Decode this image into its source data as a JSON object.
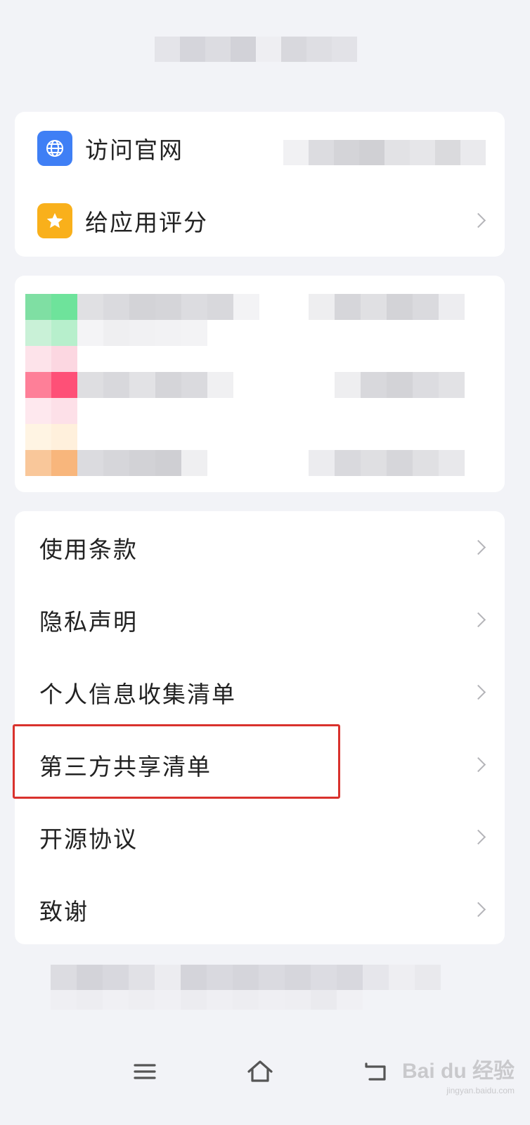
{
  "top_card": {
    "items": [
      {
        "label": "访问官网",
        "icon": "globe-icon",
        "icon_color": "#3f7ff5"
      },
      {
        "label": "给应用评分",
        "icon": "star-icon",
        "icon_color": "#f9b01b"
      }
    ]
  },
  "legal_card": {
    "items": [
      {
        "label": "使用条款"
      },
      {
        "label": "隐私声明"
      },
      {
        "label": "个人信息收集清单"
      },
      {
        "label": "第三方共享清单"
      },
      {
        "label": "开源协议"
      },
      {
        "label": "致谢"
      }
    ]
  },
  "highlighted_item": "第三方共享清单",
  "highlight_color": "#d9322d",
  "navbar": {
    "menu_icon": "menu-icon",
    "home_icon": "home-icon",
    "back_icon": "back-icon"
  },
  "watermark": {
    "main": "Bai du 经验",
    "sub": "jingyan.baidu.com"
  }
}
